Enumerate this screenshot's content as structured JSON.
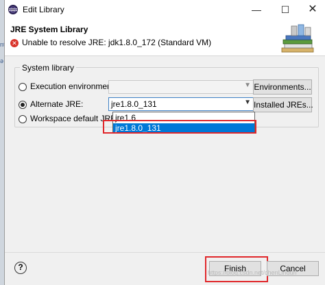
{
  "window": {
    "title": "Edit Library",
    "minimize": "—",
    "maximize": "☐",
    "close": "✕"
  },
  "header": {
    "title": "JRE System Library",
    "error_message": "Unable to resolve JRE: jdk1.8.0_172 (Standard VM)",
    "error_icon": "error-icon"
  },
  "group": {
    "label": "System library"
  },
  "options": {
    "execution_environment": {
      "label": "Execution environment:",
      "mnemonic": "E",
      "selected": false,
      "value": "",
      "button": "Environments..."
    },
    "alternate_jre": {
      "label": "Alternate JRE:",
      "selected": true,
      "value": "jre1.8.0_131",
      "button": "Installed JREs..."
    },
    "workspace_default": {
      "label": "Workspace default JRE (j",
      "selected": false
    }
  },
  "dropdown": {
    "items": [
      "jre1.6",
      "jre1.8.0_131"
    ],
    "selected_index": 1
  },
  "footer": {
    "help": "?",
    "finish": "Finish",
    "cancel": "Cancel",
    "watermark": "https://blog.csdn.net/chenLindun"
  },
  "colors": {
    "highlight": "#0078d7",
    "annotation": "#e0262a",
    "error": "#d9342b"
  }
}
